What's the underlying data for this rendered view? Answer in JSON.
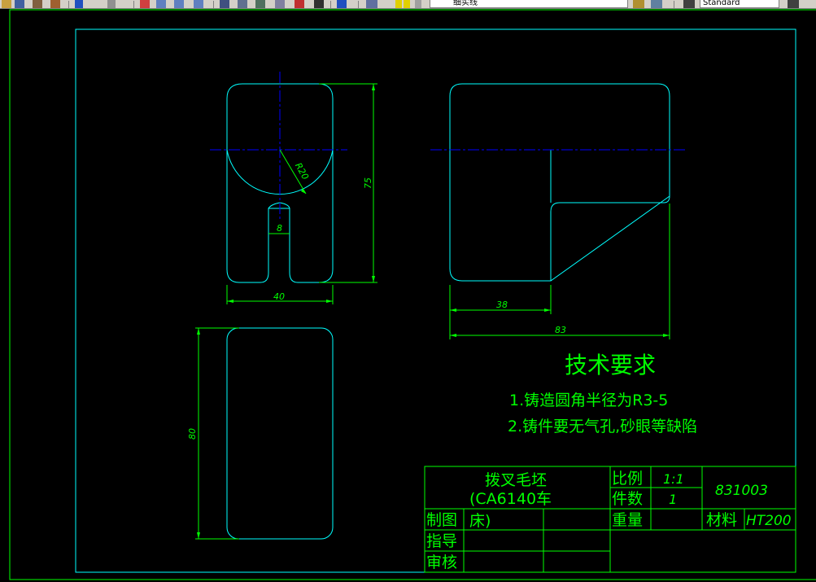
{
  "toolbar": {
    "icons": [
      "open-icon",
      "save-icon",
      "print-icon",
      "undo-icon",
      "redo-icon",
      "pan-icon",
      "zoom-realtime-icon",
      "zoom-window-icon",
      "zoom-previous-icon",
      "properties-icon",
      "design-center-icon",
      "tool-palettes-icon",
      "calculator-icon",
      "help-icon",
      "layer-manager-icon",
      "bulb-icon",
      "sun-icon",
      "lock-icon",
      "color-swatch-icon",
      "layer-states-icon",
      "text-style-icon",
      "dimension-style-icon"
    ],
    "layer_value": "细实线",
    "text_style_value": "Standard"
  },
  "colors": {
    "frame": "#00ff00",
    "outline": "#00ffff",
    "centerline": "#0000ff",
    "text": "#00ff00",
    "dim": "#00ff00"
  },
  "dimensions": {
    "radius": "R20",
    "slot_width": "8",
    "front_width": "40",
    "front_height": "75",
    "side_offset": "38",
    "side_width": "83",
    "top_height": "80"
  },
  "tech": {
    "title": "技术要求",
    "line1": "1.铸造圆角半径为R3-5",
    "line2": "2.铸件要无气孔,砂眼等缺陷"
  },
  "title_block": {
    "part_name_1": "拨叉毛坯",
    "part_name_2": "(CA6140车",
    "part_name_3": "床)",
    "scale_label": "比例",
    "scale_value": "1:1",
    "qty_label": "件数",
    "qty_value": "1",
    "weight_label": "重量",
    "drawing_no": "831003",
    "material_label": "材料",
    "material_value": "HT200",
    "drawn_label": "制图",
    "guide_label": "指导",
    "review_label": "审核"
  }
}
